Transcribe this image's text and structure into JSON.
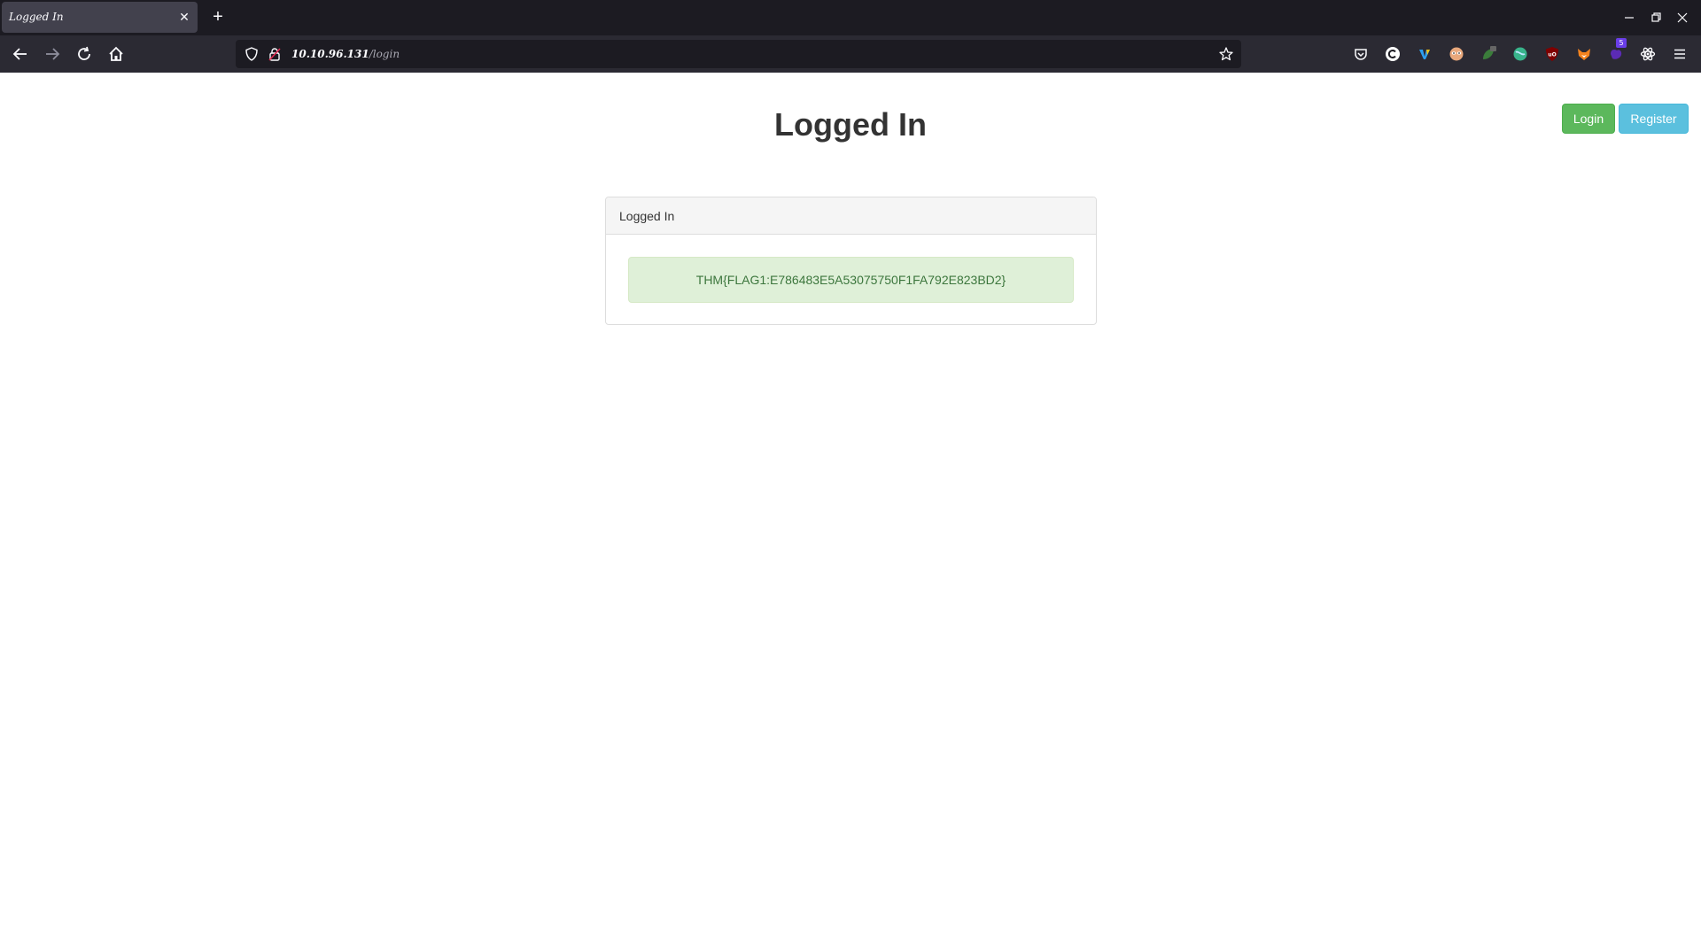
{
  "browser": {
    "tab_title": "Logged In",
    "tab_close_glyph": "✕",
    "new_tab_glyph": "+",
    "url_host": "10.10.96.131",
    "url_path": "/login",
    "extensions": [
      "pocket-icon",
      "c-extension-icon",
      "v-extension-icon",
      "mask-extension-icon",
      "leaf-extension-icon",
      "globe-extension-icon",
      "ublock-icon",
      "fox-extension-icon",
      "purple-extension-icon",
      "atom-extension-icon"
    ],
    "extension_badge": "5"
  },
  "page": {
    "title": "Logged In",
    "login_label": "Login",
    "register_label": "Register",
    "panel_heading": "Logged In",
    "flag_message": "THM{FLAG1:E786483E5A53075750F1FA792E823BD2}"
  },
  "colors": {
    "success": "#5cb85c",
    "info": "#5bc0de",
    "alert_bg": "#dff0d8",
    "alert_text": "#3c763d"
  }
}
